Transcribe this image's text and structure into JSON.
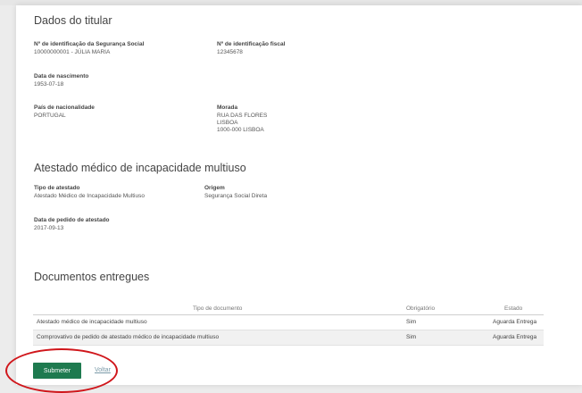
{
  "holder": {
    "title": "Dados do titular",
    "ss_id_label": "Nº de identificação da Segurança Social",
    "ss_id_value": "10000000001 - JÚLIA MARIA",
    "tax_id_label": "Nº de identificação fiscal",
    "tax_id_value": "12345678",
    "birth_label": "Data de nascimento",
    "birth_value": "1953-07-18",
    "country_label": "País de nacionalidade",
    "country_value": "PORTUGAL",
    "address_label": "Morada",
    "address_lines": [
      "RUA DAS FLORES",
      "LISBOA",
      "1000-000 LISBOA"
    ]
  },
  "certificate": {
    "title": "Atestado médico de incapacidade multiuso",
    "type_label": "Tipo de atestado",
    "type_value": "Atestado Médico de Incapacidade Multiuso",
    "origin_label": "Origem",
    "origin_value": "Segurança Social Direta",
    "request_date_label": "Data de pedido de atestado",
    "request_date_value": "2017-09-13"
  },
  "documents": {
    "title": "Documentos entregues",
    "columns": [
      "Tipo de documento",
      "Obrigatório",
      "Estado"
    ],
    "rows": [
      [
        "Atestado médico de incapacidade multiuso",
        "Sim",
        "Aguarda Entrega"
      ],
      [
        "Comprovativo de pedido de atestado médico de incapacidade multiuso",
        "Sim",
        "Aguarda Entrega"
      ]
    ]
  },
  "actions": {
    "submit_label": "Submeter",
    "back_label": "Voltar"
  },
  "colors": {
    "primary_button": "#1e7a4f",
    "highlight_ellipse": "#d0161b"
  }
}
